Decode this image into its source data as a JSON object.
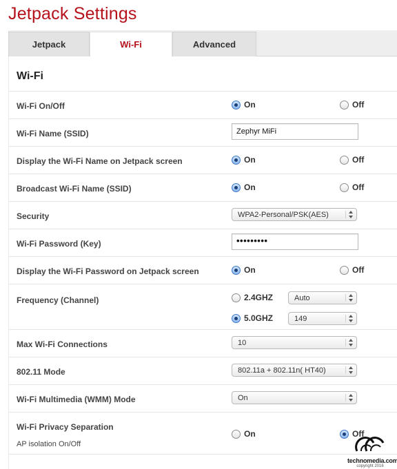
{
  "page_title": "Jetpack Settings",
  "tabs": [
    {
      "label": "Jetpack",
      "active": false
    },
    {
      "label": "Wi-Fi",
      "active": true
    },
    {
      "label": "Advanced",
      "active": false
    }
  ],
  "section_title": "Wi-Fi",
  "rows": {
    "wifi_onoff": {
      "label": "Wi-Fi On/Off",
      "on": "On",
      "off": "Off",
      "selected": "On"
    },
    "ssid": {
      "label": "Wi-Fi Name (SSID)",
      "value": "Zephyr MiFi"
    },
    "display_name": {
      "label": "Display the Wi-Fi Name on Jetpack screen",
      "on": "On",
      "off": "Off",
      "selected": "On"
    },
    "broadcast": {
      "label": "Broadcast Wi-Fi Name (SSID)",
      "on": "On",
      "off": "Off",
      "selected": "On"
    },
    "security": {
      "label": "Security",
      "value": "WPA2-Personal/PSK(AES)"
    },
    "password": {
      "label": "Wi-Fi Password (Key)",
      "value": "•••••••••"
    },
    "display_password": {
      "label": "Display the Wi-Fi Password on Jetpack screen",
      "on": "On",
      "off": "Off",
      "selected": "On"
    },
    "frequency": {
      "label": "Frequency (Channel)",
      "band1": "2.4GHZ",
      "band1_channel": "Auto",
      "band2": "5.0GHZ",
      "band2_channel": "149",
      "selected": "5.0GHZ"
    },
    "max_connections": {
      "label": "Max Wi-Fi Connections",
      "value": "10"
    },
    "mode_80211": {
      "label": "802.11 Mode",
      "value": "802.11a + 802.11n( HT40)"
    },
    "wmm": {
      "label": "Wi-Fi Multimedia (WMM) Mode",
      "value": "On"
    },
    "privacy": {
      "label": "Wi-Fi Privacy Separation",
      "sublabel": "AP isolation On/Off",
      "on": "On",
      "off": "Off",
      "selected": "Off"
    }
  },
  "watermark": {
    "brand": "technomedia.com",
    "copyright": "copyright 2016"
  },
  "colors": {
    "accent": "#b5121b",
    "radio_checked": "#3b77c9"
  }
}
